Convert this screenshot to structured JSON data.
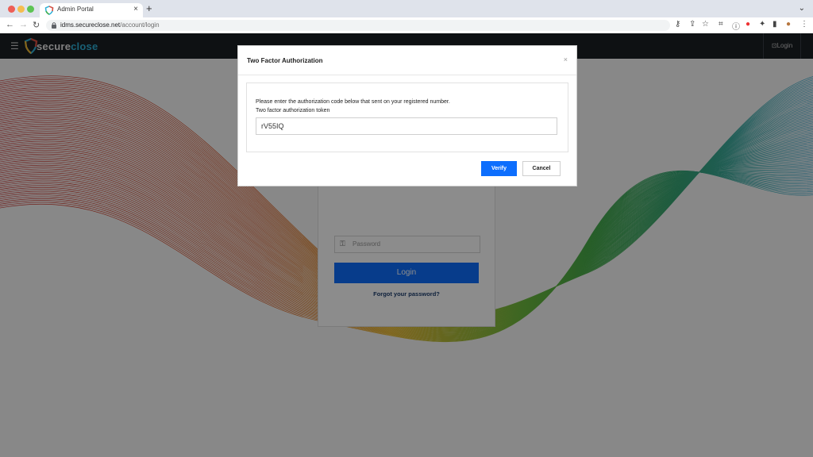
{
  "browser": {
    "tab_title": "Admin Portal",
    "tab_close": "×",
    "new_tab": "+",
    "url_host": "idms.secureclose.net",
    "url_path": "/account/login"
  },
  "app": {
    "logo_part1": "secure",
    "logo_part2": "close",
    "login_label": "Login"
  },
  "login_card": {
    "password_placeholder": "Password",
    "login_button": "Login",
    "forgot_link": "Forgot your password?"
  },
  "modal": {
    "title": "Two Factor Authorization",
    "close": "×",
    "message": "Please enter the authorization code below that sent on your registered number.",
    "token_label": "Two factor authorization token",
    "token_value": "rV55IQ",
    "verify_button": "Verify",
    "cancel_button": "Cancel"
  },
  "colors": {
    "primary": "#0d6efd",
    "header_bg": "#1b1f24",
    "logo_accent": "#2fb1d8"
  }
}
